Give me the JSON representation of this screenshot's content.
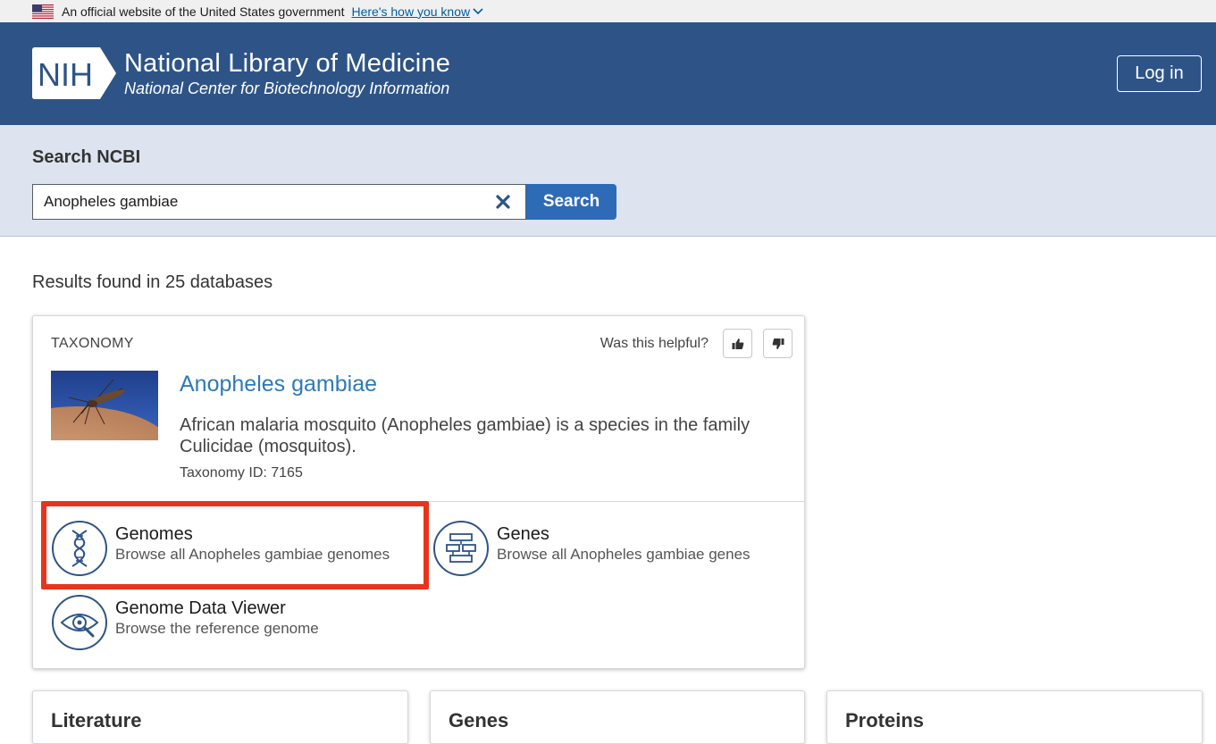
{
  "gov_banner": {
    "text": "An official website of the United States government",
    "link": "Here's how you know"
  },
  "header": {
    "badge": "NIH",
    "title": "National Library of Medicine",
    "subtitle": "National Center for Biotechnology Information",
    "login": "Log in"
  },
  "search": {
    "label": "Search NCBI",
    "query": "Anopheles gambiae",
    "button": "Search"
  },
  "results": {
    "summary": "Results found in 25 databases"
  },
  "taxonomy_card": {
    "kicker": "TAXONOMY",
    "helpful": "Was this helpful?",
    "title": "Anopheles gambiae",
    "description": "African malaria mosquito (Anopheles gambiae) is a species in the family Culicidae (mosquitos).",
    "taxonomy_id": "Taxonomy ID: 7165",
    "links": [
      {
        "title": "Genomes",
        "sub": "Browse all Anopheles gambiae genomes",
        "icon": "dna-icon"
      },
      {
        "title": "Genes",
        "sub": "Browse all Anopheles gambiae genes",
        "icon": "gene-structure-icon"
      },
      {
        "title": "Genome Data Viewer",
        "sub": "Browse the reference genome",
        "icon": "eye-search-icon"
      }
    ]
  },
  "bottom_cards": [
    {
      "title": "Literature"
    },
    {
      "title": "Genes"
    },
    {
      "title": "Proteins"
    }
  ],
  "colors": {
    "header_bg": "#2e5487",
    "search_band_bg": "#dde4ef",
    "search_button": "#2e6bb7",
    "link_blue": "#2f7ab8",
    "highlight": "#e8341c"
  }
}
